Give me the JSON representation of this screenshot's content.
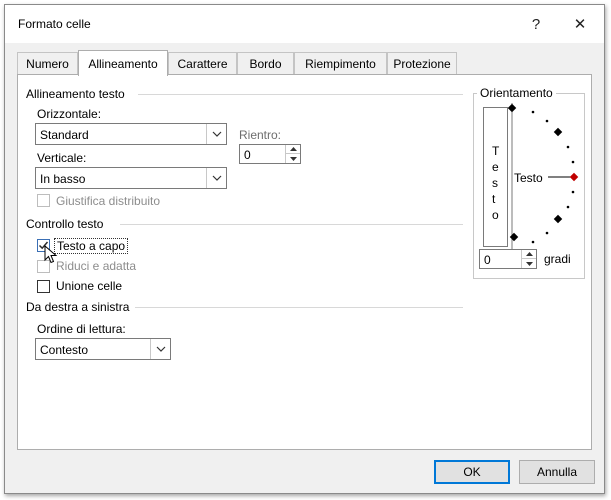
{
  "window": {
    "title": "Formato celle",
    "help_label": "?",
    "close_label": "✕"
  },
  "tabs": [
    {
      "label": "Numero"
    },
    {
      "label": "Allineamento",
      "active": true
    },
    {
      "label": "Carattere"
    },
    {
      "label": "Bordo"
    },
    {
      "label": "Riempimento"
    },
    {
      "label": "Protezione"
    }
  ],
  "alignment": {
    "section": "Allineamento testo",
    "horizontal_label": "Orizzontale:",
    "horizontal_value": "Standard",
    "indent_label": "Rientro:",
    "indent_value": "0",
    "vertical_label": "Verticale:",
    "vertical_value": "In basso",
    "justify_distributed_label": "Giustifica distribuito"
  },
  "text_control": {
    "section": "Controllo testo",
    "wrap_label": "Testo a capo",
    "wrap_checked": true,
    "shrink_label": "Riduci e adatta",
    "merge_label": "Unione celle"
  },
  "rtl": {
    "section": "Da destra a sinistra",
    "order_label": "Ordine di lettura:",
    "order_value": "Contesto"
  },
  "orientation": {
    "section": "Orientamento",
    "vertical_text": [
      "T",
      "e",
      "s",
      "t",
      "o"
    ],
    "dial_text": "Testo",
    "degrees_value": "0",
    "degrees_label": "gradi"
  },
  "footer": {
    "ok_label": "OK",
    "cancel_label": "Annulla"
  },
  "colors": {
    "accent": "#0078d7",
    "dial_pointer": "#c00000"
  }
}
